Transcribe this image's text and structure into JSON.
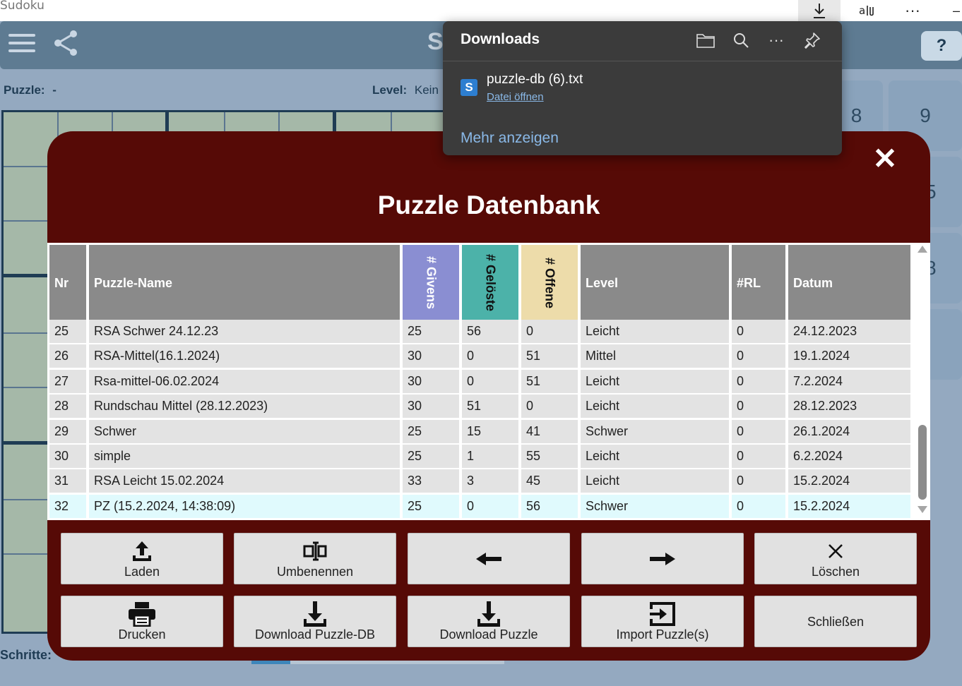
{
  "browser": {
    "title": "Sudoku"
  },
  "app": {
    "title_fragment": "S",
    "help_label": "?",
    "puzzle_label": "Puzzle:",
    "puzzle_value": "-",
    "level_label": "Level:",
    "level_value": "Kein",
    "steps_label": "Schritte:",
    "numpad": [
      "8",
      "9",
      "5",
      "8"
    ]
  },
  "downloads": {
    "title": "Downloads",
    "file_name": "puzzle-db (6).txt",
    "file_icon_letter": "S",
    "open_label": "Datei öffnen",
    "more_label": "Mehr anzeigen"
  },
  "modal": {
    "close_label": "✕",
    "title": "Puzzle Datenbank",
    "columns": [
      "Nr",
      "Puzzle-Name",
      "# Givens",
      "# Gelöste",
      "# Offene",
      "Level",
      "#RL",
      "Datum"
    ],
    "rows": [
      [
        "25",
        "RSA Schwer 24.12.23",
        "25",
        "56",
        "0",
        "Leicht",
        "0",
        "24.12.2023"
      ],
      [
        "26",
        "RSA-Mittel(16.1.2024)",
        "30",
        "0",
        "51",
        "Mittel",
        "0",
        "19.1.2024"
      ],
      [
        "27",
        "Rsa-mittel-06.02.2024",
        "30",
        "0",
        "51",
        "Leicht",
        "0",
        "7.2.2024"
      ],
      [
        "28",
        "Rundschau Mittel (28.12.2023)",
        "30",
        "51",
        "0",
        "Leicht",
        "0",
        "28.12.2023"
      ],
      [
        "29",
        "Schwer",
        "25",
        "15",
        "41",
        "Schwer",
        "0",
        "26.1.2024"
      ],
      [
        "30",
        "simple",
        "25",
        "1",
        "55",
        "Leicht",
        "0",
        "6.2.2024"
      ],
      [
        "31",
        "RSA Leicht 15.02.2024",
        "33",
        "3",
        "45",
        "Leicht",
        "0",
        "15.2.2024"
      ],
      [
        "32",
        "PZ (15.2.2024, 14:38:09)",
        "25",
        "0",
        "56",
        "Schwer",
        "0",
        "15.2.2024"
      ]
    ],
    "selected_row": 7,
    "buttons": {
      "load": "Laden",
      "rename": "Umbenennen",
      "prev": "",
      "next": "",
      "delete": "Löschen",
      "print": "Drucken",
      "download_db": "Download Puzzle-DB",
      "download_puzzle": "Download Puzzle",
      "import": "Import Puzzle(s)",
      "close": "Schließen"
    }
  },
  "colors": {
    "modal_bg": "#560a06",
    "header_gray": "#8a8a8a",
    "givens": "#8a8ed2",
    "geloeste": "#4cb2a9",
    "offene": "#eddcaa",
    "selected_row": "#e0fafd",
    "app_header": "#5e7b92"
  }
}
